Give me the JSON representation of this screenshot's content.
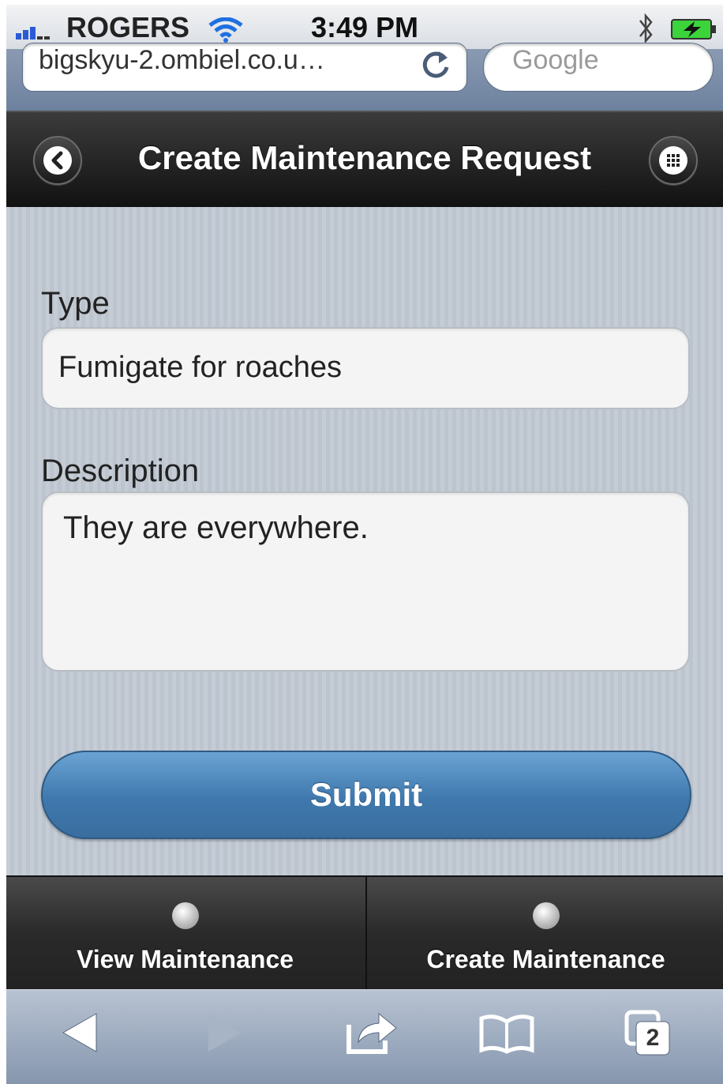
{
  "status_bar": {
    "carrier": "ROGERS",
    "time": "3:49 PM",
    "icons": [
      "signal-icon",
      "wifi-icon",
      "bluetooth-icon",
      "battery-charging-icon"
    ]
  },
  "browser": {
    "url": "bigskyu-2.ombiel.co.u…",
    "search_placeholder": "Google"
  },
  "header": {
    "title": "Create Maintenance Request",
    "icons": [
      "back-chevron-icon",
      "grid-menu-icon"
    ]
  },
  "form": {
    "type_label": "Type",
    "type_value": "Fumigate for roaches",
    "description_label": "Description",
    "description_value": "They are everywhere.",
    "submit_label": "Submit"
  },
  "tab_bar": {
    "items": [
      {
        "label": "View Maintenance"
      },
      {
        "label": "Create Maintenance"
      }
    ]
  },
  "toolbar": {
    "tab_count": "2",
    "icons": [
      "back-arrow-icon",
      "forward-arrow-icon",
      "share-icon",
      "bookmarks-icon",
      "tabs-icon"
    ]
  },
  "colors": {
    "submit_button": "#4a84bb",
    "header_bar": "#1a1a1a",
    "tab_bar": "#2e2e2e",
    "content_background": "#c5ccd5"
  }
}
